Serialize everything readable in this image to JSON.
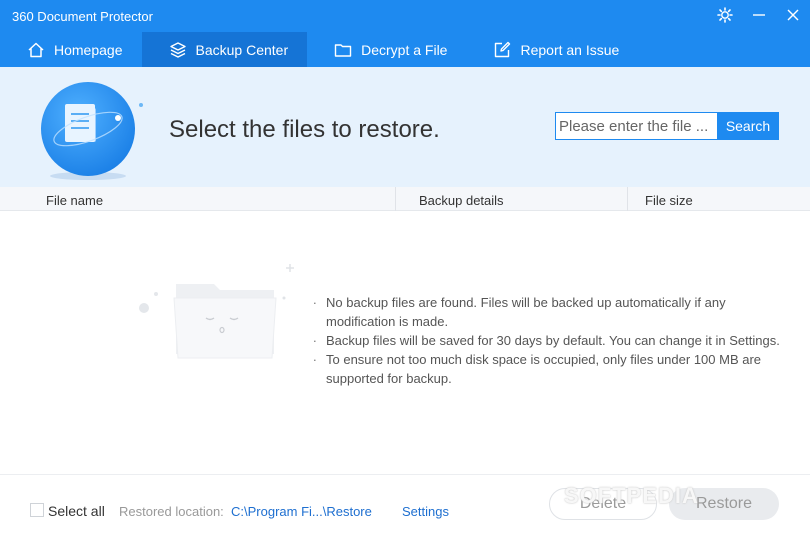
{
  "window": {
    "title": "360 Document Protector",
    "controls": [
      {
        "name": "settings-icon"
      },
      {
        "name": "minimize-icon"
      },
      {
        "name": "close-icon"
      }
    ]
  },
  "nav": {
    "items": [
      {
        "label": "Homepage",
        "icon": "home-icon",
        "active": false
      },
      {
        "label": "Backup Center",
        "icon": "layers-icon",
        "active": true
      },
      {
        "label": "Decrypt a File",
        "icon": "folder-icon",
        "active": false
      },
      {
        "label": "Report an Issue",
        "icon": "edit-icon",
        "active": false
      }
    ]
  },
  "header": {
    "heading": "Select the files to restore.",
    "search": {
      "placeholder": "Please enter the file ...",
      "button_label": "Search"
    }
  },
  "table": {
    "columns": [
      "File name",
      "Backup details",
      "File size"
    ],
    "rows": []
  },
  "empty_state": {
    "messages": [
      "No backup files are found. Files will be backed up automatically if any modification is made.",
      "Backup files will be saved for 30 days by default. You can change it in Settings.",
      "To ensure not too much disk space is occupied, only files under 100 MB are supported for backup."
    ]
  },
  "footer": {
    "select_all_label": "Select all",
    "select_all_checked": false,
    "restored_location_label": "Restored location:",
    "restored_location_path": "C:\\Program Fi...\\Restore",
    "settings_label": "Settings",
    "delete_label": "Delete",
    "restore_label": "Restore"
  },
  "watermark": "SOFTPEDIA",
  "colors": {
    "accent": "#1e8af0",
    "accent_dark": "#1574d6",
    "header_bg": "#e6f2fd",
    "link": "#1e6fd0"
  }
}
